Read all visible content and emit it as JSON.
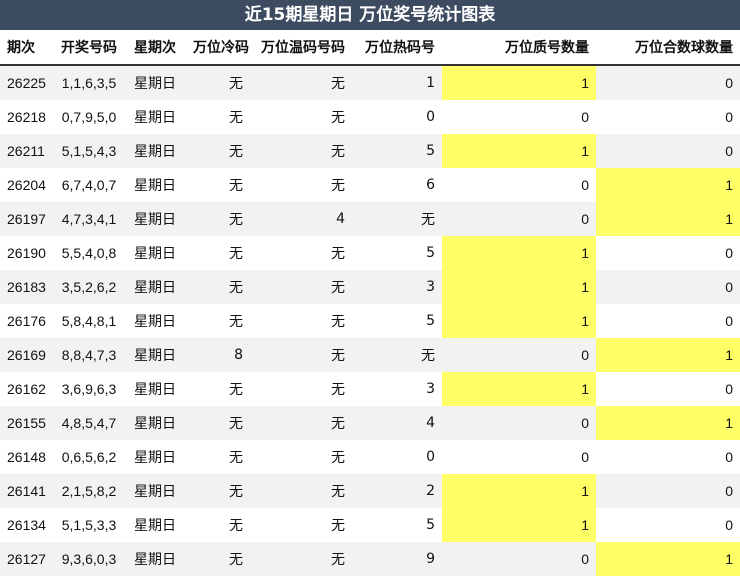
{
  "title": "近15期星期日 万位奖号统计图表",
  "headers": [
    "期次",
    "开奖号码",
    "星期次",
    "万位冷码",
    "万位温码号码",
    "万位热码号",
    "万位质号数量",
    "万位合数球数量"
  ],
  "highlight_color": "#ffff66",
  "rows": [
    {
      "issue": "26225",
      "numbers": "1,1,6,3,5",
      "weekday": "星期日",
      "cold": "无",
      "warm": "无",
      "hot": "1",
      "prime": "1",
      "composite": "0"
    },
    {
      "issue": "26218",
      "numbers": "0,7,9,5,0",
      "weekday": "星期日",
      "cold": "无",
      "warm": "无",
      "hot": "0",
      "prime": "0",
      "composite": "0"
    },
    {
      "issue": "26211",
      "numbers": "5,1,5,4,3",
      "weekday": "星期日",
      "cold": "无",
      "warm": "无",
      "hot": "5",
      "prime": "1",
      "composite": "0"
    },
    {
      "issue": "26204",
      "numbers": "6,7,4,0,7",
      "weekday": "星期日",
      "cold": "无",
      "warm": "无",
      "hot": "6",
      "prime": "0",
      "composite": "1"
    },
    {
      "issue": "26197",
      "numbers": "4,7,3,4,1",
      "weekday": "星期日",
      "cold": "无",
      "warm": "4",
      "hot": "无",
      "prime": "0",
      "composite": "1"
    },
    {
      "issue": "26190",
      "numbers": "5,5,4,0,8",
      "weekday": "星期日",
      "cold": "无",
      "warm": "无",
      "hot": "5",
      "prime": "1",
      "composite": "0"
    },
    {
      "issue": "26183",
      "numbers": "3,5,2,6,2",
      "weekday": "星期日",
      "cold": "无",
      "warm": "无",
      "hot": "3",
      "prime": "1",
      "composite": "0"
    },
    {
      "issue": "26176",
      "numbers": "5,8,4,8,1",
      "weekday": "星期日",
      "cold": "无",
      "warm": "无",
      "hot": "5",
      "prime": "1",
      "composite": "0"
    },
    {
      "issue": "26169",
      "numbers": "8,8,4,7,3",
      "weekday": "星期日",
      "cold": "8",
      "warm": "无",
      "hot": "无",
      "prime": "0",
      "composite": "1"
    },
    {
      "issue": "26162",
      "numbers": "3,6,9,6,3",
      "weekday": "星期日",
      "cold": "无",
      "warm": "无",
      "hot": "3",
      "prime": "1",
      "composite": "0"
    },
    {
      "issue": "26155",
      "numbers": "4,8,5,4,7",
      "weekday": "星期日",
      "cold": "无",
      "warm": "无",
      "hot": "4",
      "prime": "0",
      "composite": "1"
    },
    {
      "issue": "26148",
      "numbers": "0,6,5,6,2",
      "weekday": "星期日",
      "cold": "无",
      "warm": "无",
      "hot": "0",
      "prime": "0",
      "composite": "0"
    },
    {
      "issue": "26141",
      "numbers": "2,1,5,8,2",
      "weekday": "星期日",
      "cold": "无",
      "warm": "无",
      "hot": "2",
      "prime": "1",
      "composite": "0"
    },
    {
      "issue": "26134",
      "numbers": "5,1,5,3,3",
      "weekday": "星期日",
      "cold": "无",
      "warm": "无",
      "hot": "5",
      "prime": "1",
      "composite": "0"
    },
    {
      "issue": "26127",
      "numbers": "9,3,6,0,3",
      "weekday": "星期日",
      "cold": "无",
      "warm": "无",
      "hot": "9",
      "prime": "0",
      "composite": "1"
    }
  ]
}
